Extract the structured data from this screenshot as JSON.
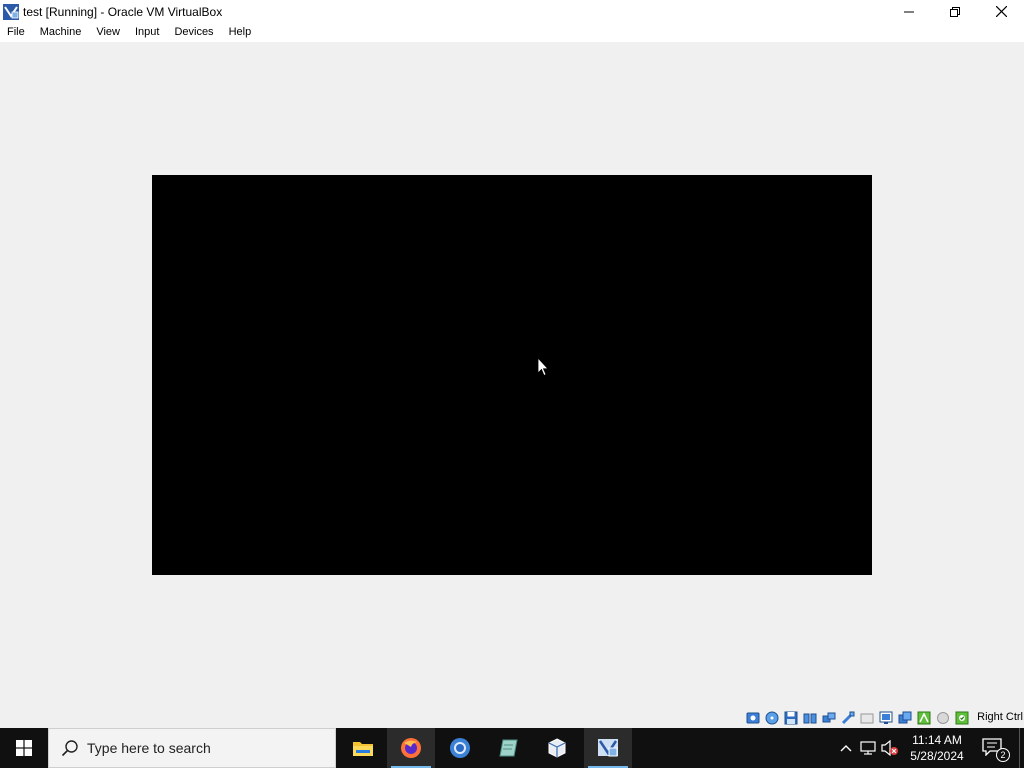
{
  "window": {
    "title": "test [Running] - Oracle VM VirtualBox",
    "controls": [
      "minimize-icon",
      "restore-icon",
      "close-icon"
    ]
  },
  "menu": {
    "items": [
      "File",
      "Machine",
      "View",
      "Input",
      "Devices",
      "Help"
    ]
  },
  "statusbar": {
    "icons": [
      "hard-disk-icon",
      "optical-drive-icon",
      "floppy-drive-icon",
      "audio-icon",
      "network-icon",
      "usb-icon",
      "shared-folders-icon",
      "display-icon",
      "video-capture-icon",
      "guest-additions-icon",
      "mouse-integration-icon",
      "keyboard-icon",
      "cpu-icon"
    ],
    "host_key": "Right Ctrl"
  },
  "taskbar": {
    "search_placeholder": "Type here to search",
    "apps": [
      "file-explorer-icon",
      "firefox-icon",
      "chrome-icon",
      "notepad-icon",
      "virtualbox-manager-icon",
      "virtualbox-vm-icon"
    ],
    "clock_time": "11:14 AM",
    "clock_date": "5/28/2024",
    "notification_count": "2"
  },
  "colors": {
    "accent": "#76b9ed",
    "taskbar_bg": "#101010",
    "window_bg": "#f0f0f0",
    "vm_screen": "#000000"
  }
}
